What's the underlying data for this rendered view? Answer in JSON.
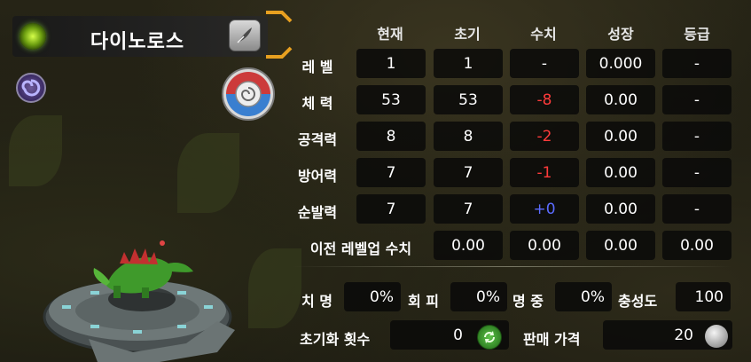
{
  "monster": {
    "name": "다이노로스",
    "element_icon": "grass-element-icon",
    "rename_icon": "rename-quill-icon",
    "skill_icon": "purple-swirl-icon",
    "fossil_icon": "fossil-shell-icon"
  },
  "stats": {
    "columns": [
      "현재",
      "초기",
      "수치",
      "성장",
      "등급"
    ],
    "rows": [
      {
        "label": "레 벨",
        "values": [
          "1",
          "1",
          "-",
          "0.000",
          "-"
        ],
        "delta_sign": "none"
      },
      {
        "label": "체 력",
        "values": [
          "53",
          "53",
          "-8",
          "0.00",
          "-"
        ],
        "delta_sign": "negative"
      },
      {
        "label": "공격력",
        "values": [
          "8",
          "8",
          "-2",
          "0.00",
          "-"
        ],
        "delta_sign": "negative"
      },
      {
        "label": "방어력",
        "values": [
          "7",
          "7",
          "-1",
          "0.00",
          "-"
        ],
        "delta_sign": "negative"
      },
      {
        "label": "순발력",
        "values": [
          "7",
          "7",
          "+0",
          "0.00",
          "-"
        ],
        "delta_sign": "positive"
      }
    ],
    "prev_levelup": {
      "label": "이전 레벨업 수치",
      "values": [
        "0.00",
        "0.00",
        "0.00",
        "0.00"
      ]
    }
  },
  "extra": {
    "crit": {
      "label": "치 명",
      "value": "0%"
    },
    "evade": {
      "label": "회 피",
      "value": "0%"
    },
    "accuracy": {
      "label": "명 중",
      "value": "0%"
    },
    "loyalty": {
      "label": "충성도",
      "value": "100"
    },
    "reset_count": {
      "label": "초기화 횟수",
      "value": "0"
    },
    "sell_price": {
      "label": "판매 가격",
      "value": "20"
    }
  },
  "colors": {
    "negative": "#ff3b3b",
    "positive": "#5b6bff",
    "cell_bg": "#080808",
    "accent_orange": "#e8a020"
  }
}
